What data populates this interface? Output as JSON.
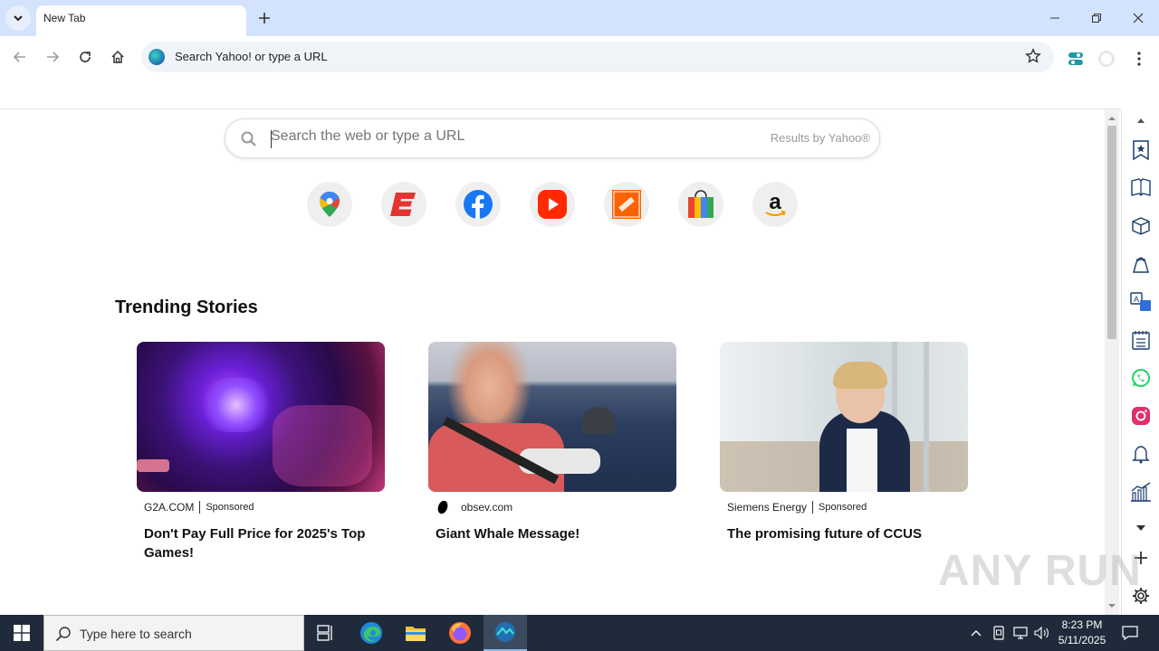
{
  "browser": {
    "tab_title": "New Tab",
    "omnibox_placeholder": "Search Yahoo! or type a URL"
  },
  "search": {
    "placeholder": "Search the web or type a URL",
    "provider": "Results by Yahoo®"
  },
  "shortcuts": [
    {
      "name": "google-maps",
      "icon": "maps-pin-icon"
    },
    {
      "name": "espn",
      "icon": "espn-icon"
    },
    {
      "name": "facebook",
      "icon": "facebook-icon"
    },
    {
      "name": "youtube",
      "icon": "youtube-icon"
    },
    {
      "name": "home-depot",
      "icon": "home-depot-icon"
    },
    {
      "name": "shopping",
      "icon": "shopping-bag-icon"
    },
    {
      "name": "amazon",
      "icon": "amazon-icon"
    }
  ],
  "trending": {
    "heading": "Trending Stories",
    "cards": [
      {
        "source": "G2A.COM",
        "sponsored": "Sponsored",
        "title": "Don't Pay Full Price for 2025's Top Games!"
      },
      {
        "source": "obsev.com",
        "sponsored": "",
        "title": "Giant Whale Message!"
      },
      {
        "source": "Siemens Energy",
        "sponsored": "Sponsored",
        "title": "The promising future of CCUS"
      }
    ]
  },
  "taskbar": {
    "search_placeholder": "Type here to search",
    "time": "8:23 PM",
    "date": "5/11/2025"
  },
  "watermark": "ANY RUN"
}
